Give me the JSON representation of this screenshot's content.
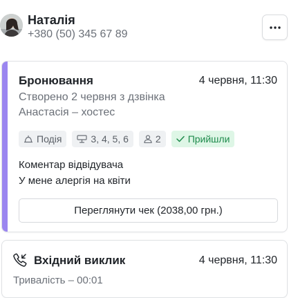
{
  "contact": {
    "name": "Наталія",
    "phone": "+380 (50) 345 67 89"
  },
  "menu": {
    "icon": "more-dots-icon"
  },
  "booking": {
    "title": "Бронювання",
    "datetime": "4 червня, 11:30",
    "created": "Створено 2 червня з дзвінка",
    "host": "Анастасія – хостес",
    "accent_color": "#9b86f0",
    "tags": [
      {
        "icon": "event-icon",
        "label": "Подія"
      },
      {
        "icon": "table-icon",
        "label": "3, 4, 5, 6"
      },
      {
        "icon": "person-icon",
        "label": "2"
      },
      {
        "icon": "check-icon",
        "label": "Прийшли",
        "color": "#1d8a4b"
      }
    ],
    "comment_label": "Коментар відвідувача",
    "comment_text": "У мене алергія на квіти",
    "receipt_button": "Переглянути чек (2038,00 грн.)"
  },
  "call": {
    "icon": "incoming-call-icon",
    "title": "Вхідний виклик",
    "datetime": "4 червня, 11:30",
    "duration": "Тривалість – 00:01"
  }
}
